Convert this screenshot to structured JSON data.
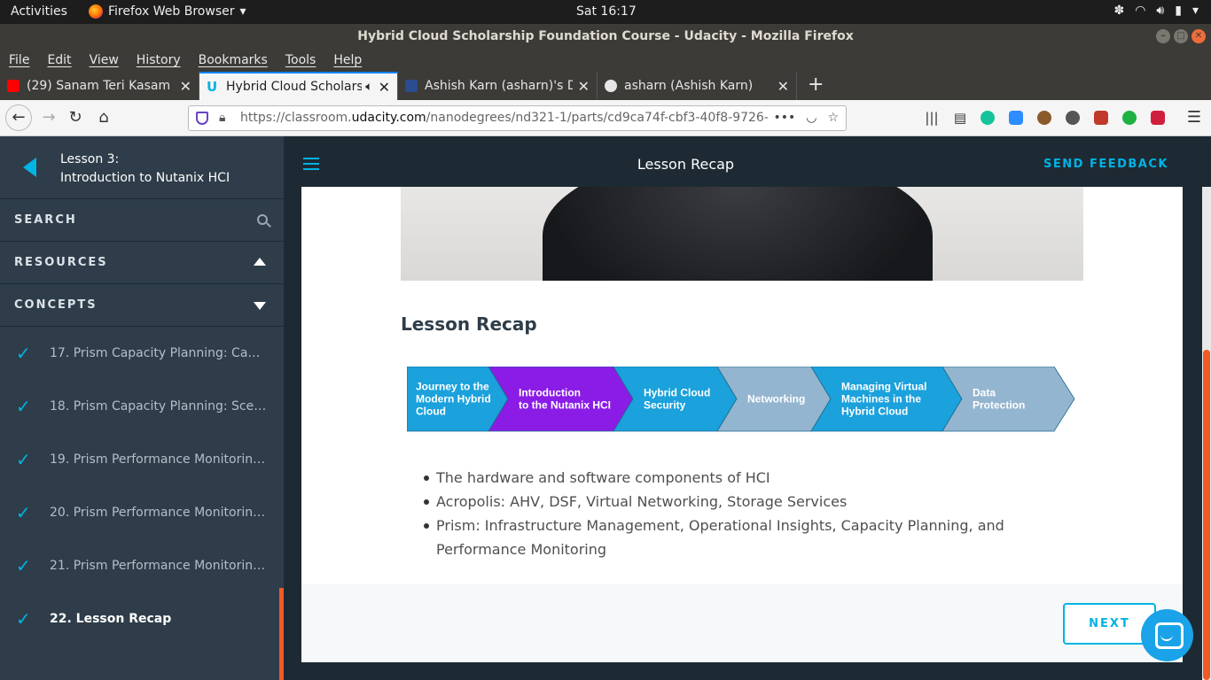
{
  "system": {
    "activities": "Activities",
    "app_name": "Firefox Web Browser",
    "clock": "Sat 16:17"
  },
  "window": {
    "title": "Hybrid Cloud Scholarship Foundation Course - Udacity - Mozilla Firefox"
  },
  "menu": [
    "File",
    "Edit",
    "View",
    "History",
    "Bookmarks",
    "Tools",
    "Help"
  ],
  "tabs": [
    {
      "label": "(29) Sanam Teri Kasam Fu",
      "icon": "youtube-icon",
      "color": "#ff0000"
    },
    {
      "label": "Hybrid Cloud Scholarsh",
      "icon": "udacity-icon",
      "color": "#02b3e4"
    },
    {
      "label": "Ashish Karn (asharn)'s De",
      "icon": "profile-icon",
      "color": "#2a4d8f"
    },
    {
      "label": "asharn (Ashish Karn)",
      "icon": "github-icon",
      "color": "#e6e6e6"
    }
  ],
  "url": {
    "prefix": "https://classroom.",
    "host": "udacity.com",
    "path": "/nanodegrees/nd321-1/parts/cd9ca74f-cbf3-40f8-9726-"
  },
  "sidebar": {
    "lesson_line1": "Lesson 3:",
    "lesson_line2": "Introduction to Nutanix HCI",
    "search": "SEARCH",
    "resources": "RESOURCES",
    "concepts": "CONCEPTS",
    "items": [
      {
        "label": "17. Prism Capacity Planning: Capac…",
        "done": true
      },
      {
        "label": "18. Prism Capacity Planning: Scena…",
        "done": true
      },
      {
        "label": "19. Prism Performance Monitoring…",
        "done": true
      },
      {
        "label": "20. Prism Performance Monitoring…",
        "done": true
      },
      {
        "label": "21. Prism Performance Monitoring…",
        "done": true
      },
      {
        "label": "22. Lesson Recap",
        "done": true,
        "current": true
      }
    ]
  },
  "header": {
    "title": "Lesson Recap",
    "feedback": "SEND FEEDBACK"
  },
  "content": {
    "heading": "Lesson Recap",
    "flow": [
      {
        "lines": [
          "Journey to the",
          "Modern Hybrid",
          "Cloud"
        ],
        "color": "#1ba1dc"
      },
      {
        "lines": [
          "Introduction",
          "to the Nutanix HCI"
        ],
        "color": "#8a1ce6"
      },
      {
        "lines": [
          "Hybrid Cloud",
          "Security"
        ],
        "color": "#1ba1dc"
      },
      {
        "lines": [
          "Networking"
        ],
        "color": "#94b5cf"
      },
      {
        "lines": [
          "Managing Virtual",
          "Machines in the",
          "Hybrid Cloud"
        ],
        "color": "#1ba1dc"
      },
      {
        "lines": [
          "Data",
          "Protection"
        ],
        "color": "#94b5cf"
      }
    ],
    "bullets": [
      "The hardware and software components of HCI",
      "Acropolis: AHV, DSF, Virtual Networking, Storage Services",
      "Prism: Infrastructure Management, Operational Insights, Capacity Planning, and Performance Monitoring"
    ],
    "next": "NEXT"
  }
}
